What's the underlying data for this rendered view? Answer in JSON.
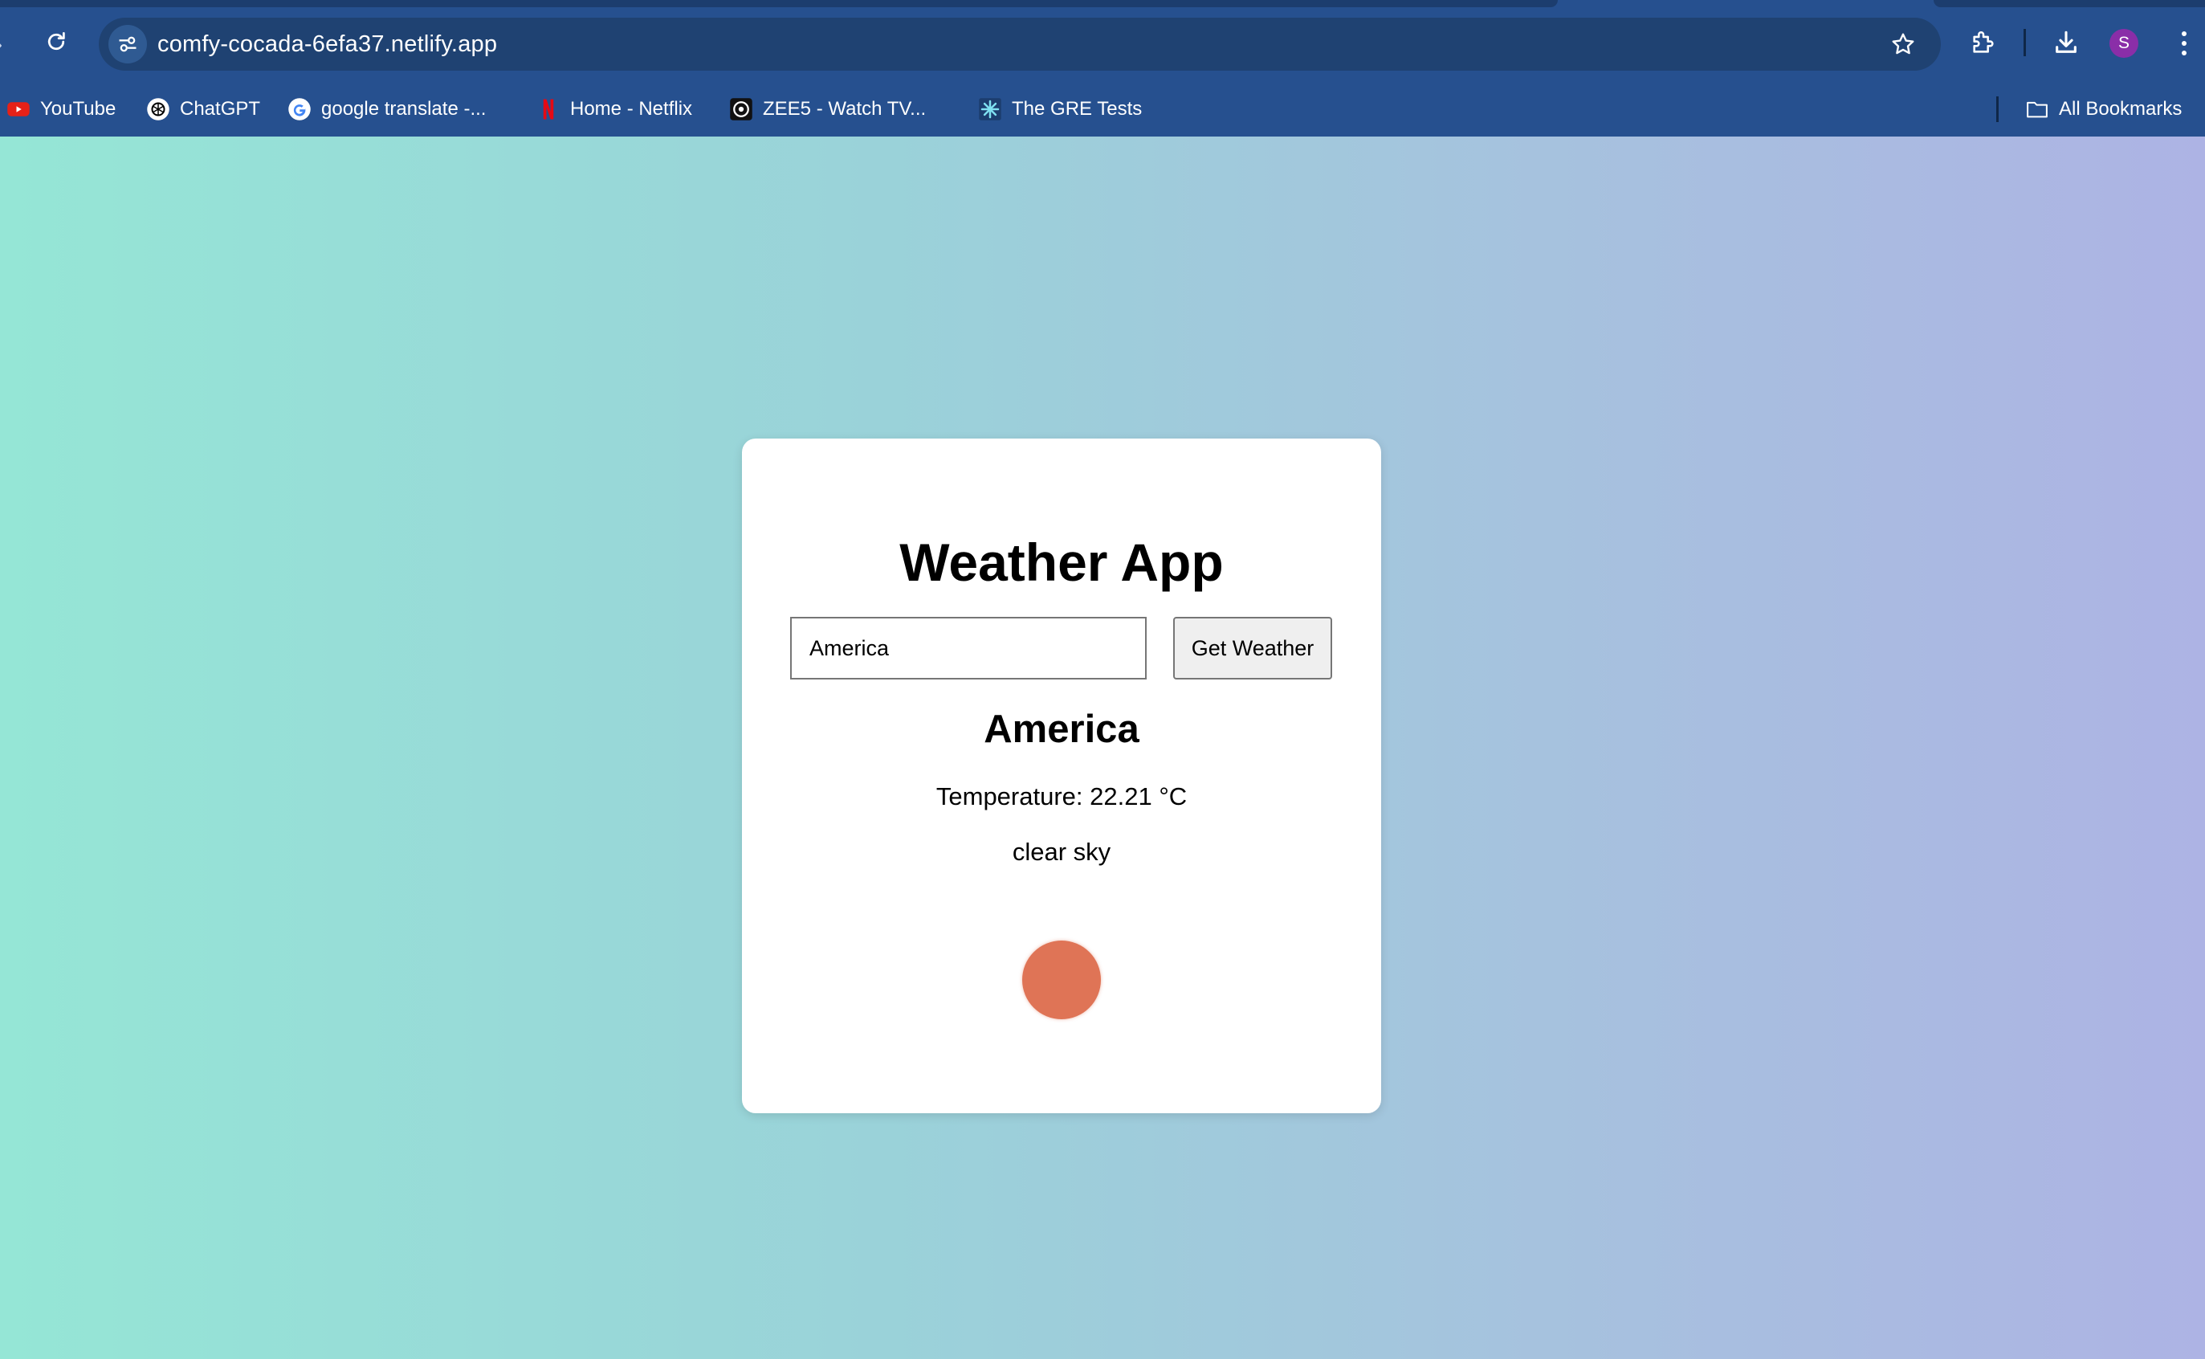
{
  "browser": {
    "url": "comfy-cocada-6efa37.netlify.app",
    "profile_initial": "S",
    "bookmarks": [
      {
        "label": "YouTube",
        "icon": "youtube-icon"
      },
      {
        "label": "ChatGPT",
        "icon": "chatgpt-icon"
      },
      {
        "label": "google translate -...",
        "icon": "google-icon"
      },
      {
        "label": "Home - Netflix",
        "icon": "netflix-icon"
      },
      {
        "label": "ZEE5 - Watch TV...",
        "icon": "zee5-icon"
      },
      {
        "label": "The GRE Tests",
        "icon": "gre-icon"
      }
    ],
    "all_bookmarks_label": "All Bookmarks"
  },
  "app": {
    "title": "Weather App",
    "search": {
      "value": "America",
      "button_label": "Get Weather"
    },
    "result": {
      "city": "America",
      "temperature": "Temperature: 22.21 °C",
      "description": "clear sky",
      "icon": "sun-icon"
    }
  },
  "colors": {
    "chrome": "#26508f",
    "omnibox": "#1f4272",
    "background_start": "#95e6d6",
    "background_end": "#adb3e4",
    "card": "#ffffff",
    "sun": "#df7456",
    "avatar": "#8a2ea8"
  }
}
